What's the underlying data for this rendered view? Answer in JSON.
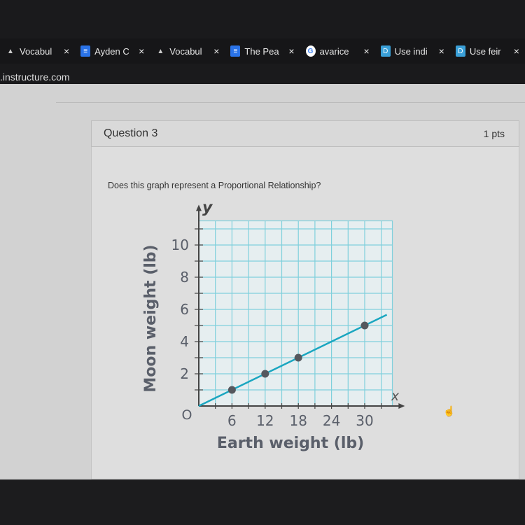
{
  "browser": {
    "tabs": [
      {
        "label": "Vocabul",
        "icon": "classroom-icon",
        "color": "#444444"
      },
      {
        "label": "Ayden C",
        "icon": "docs-icon",
        "color": "#2a73e8"
      },
      {
        "label": "Vocabul",
        "icon": "classroom-icon",
        "color": "#444444"
      },
      {
        "label": "The Pea",
        "icon": "docs-icon",
        "color": "#2a73e8"
      },
      {
        "label": "avarice",
        "icon": "google-icon",
        "color": "#ffffff"
      },
      {
        "label": "Use indi",
        "icon": "yourdictionary-icon",
        "color": "#3aa0d8"
      },
      {
        "label": "Use feir",
        "icon": "yourdictionary-icon",
        "color": "#3aa0d8"
      }
    ],
    "url": ".instructure.com"
  },
  "question": {
    "title": "Question 3",
    "points": "1 pts",
    "prompt": "Does this graph represent a Proportional Relationship?"
  },
  "chart_data": {
    "type": "line",
    "xlabel": "Earth weight (lb)",
    "ylabel": "Moon weight (lb)",
    "x_axis_letter": "x",
    "y_axis_letter": "y",
    "origin_label": "O",
    "x_ticks": [
      6,
      12,
      18,
      24,
      30
    ],
    "y_ticks": [
      2,
      4,
      6,
      8,
      10
    ],
    "xlim": [
      0,
      35
    ],
    "ylim": [
      0,
      11.5
    ],
    "grid": true,
    "points": [
      {
        "x": 6,
        "y": 1
      },
      {
        "x": 12,
        "y": 2
      },
      {
        "x": 18,
        "y": 3
      },
      {
        "x": 30,
        "y": 5
      }
    ],
    "line": {
      "from": [
        0,
        0
      ],
      "to": [
        34,
        5.67
      ]
    },
    "colors": {
      "grid": "#7fd0dc",
      "line": "#1aa6c0",
      "point": "#55585e",
      "text": "#5a5f6a"
    }
  }
}
